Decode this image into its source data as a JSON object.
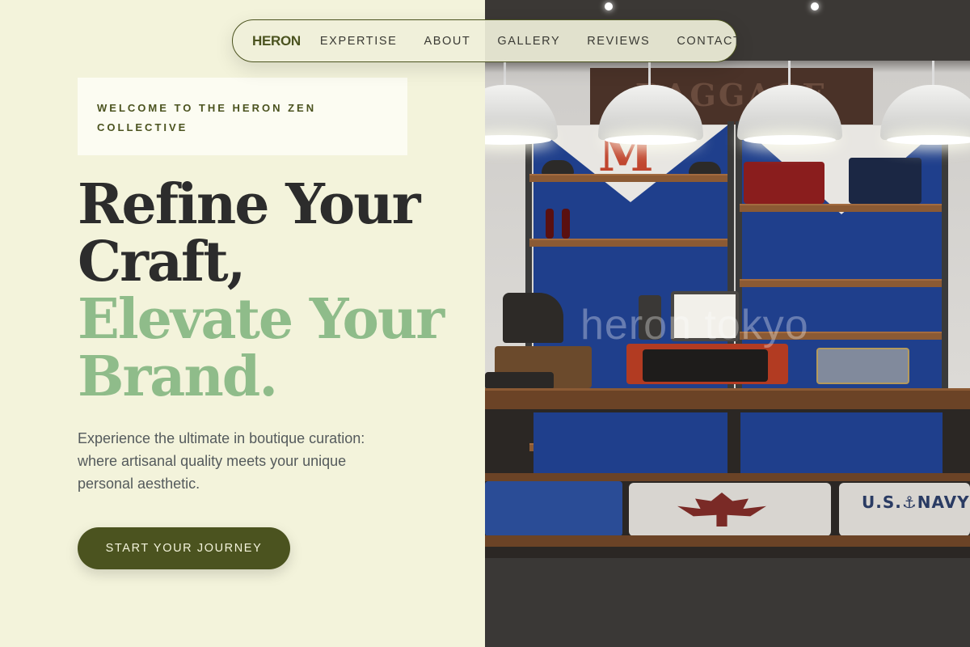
{
  "nav": {
    "logo": "HERON",
    "links": [
      "EXPERTISE",
      "ABOUT",
      "GALLERY",
      "REVIEWS",
      "CONTACT"
    ]
  },
  "hero": {
    "welcome_line1": "WELCOME TO THE HERON ZEN",
    "welcome_line2": "COLLECTIVE",
    "headline_line1": "Refine Your",
    "headline_line2": "Craft,",
    "headline_line3": "Elevate Your",
    "headline_line4": "Brand.",
    "subtitle": "Experience the ultimate in boutique curation: where artisanal quality meets your unique personal aesthetic.",
    "cta_label": "START YOUR JOURNEY"
  },
  "image": {
    "banner_text": "BAGGAGE",
    "shelf_letter": "M",
    "shirt_text": "U.S.⚓NAVY",
    "watermark": "heron tokyo"
  },
  "colors": {
    "background": "#f3f3db",
    "olive": "#4b531f",
    "sage": "#8fbc8a",
    "text_dark": "#2c2c2c",
    "text_body": "#545a5c"
  }
}
